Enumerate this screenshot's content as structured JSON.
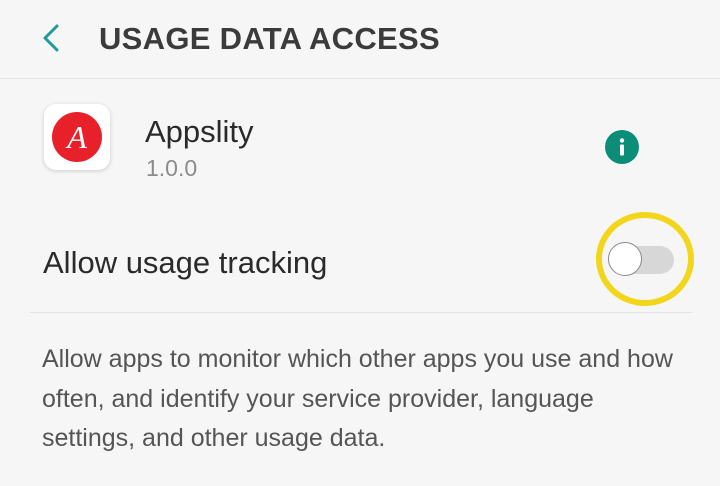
{
  "header": {
    "title": "USAGE DATA ACCESS",
    "back_icon": "chevron-left-icon"
  },
  "app": {
    "name": "Appslity",
    "version": "1.0.0",
    "icon_letter": "A",
    "icon_color": "#e8202a",
    "info_icon": "info-icon",
    "info_color": "#0b8d78"
  },
  "setting": {
    "label": "Allow usage tracking",
    "enabled": false,
    "highlight_color": "#f3d51b"
  },
  "description": "Allow apps to monitor which other apps you use and how often, and identify your service provider, language settings, and other usage data.",
  "colors": {
    "accent": "#1d9a9a",
    "background": "#f6f6f6"
  }
}
